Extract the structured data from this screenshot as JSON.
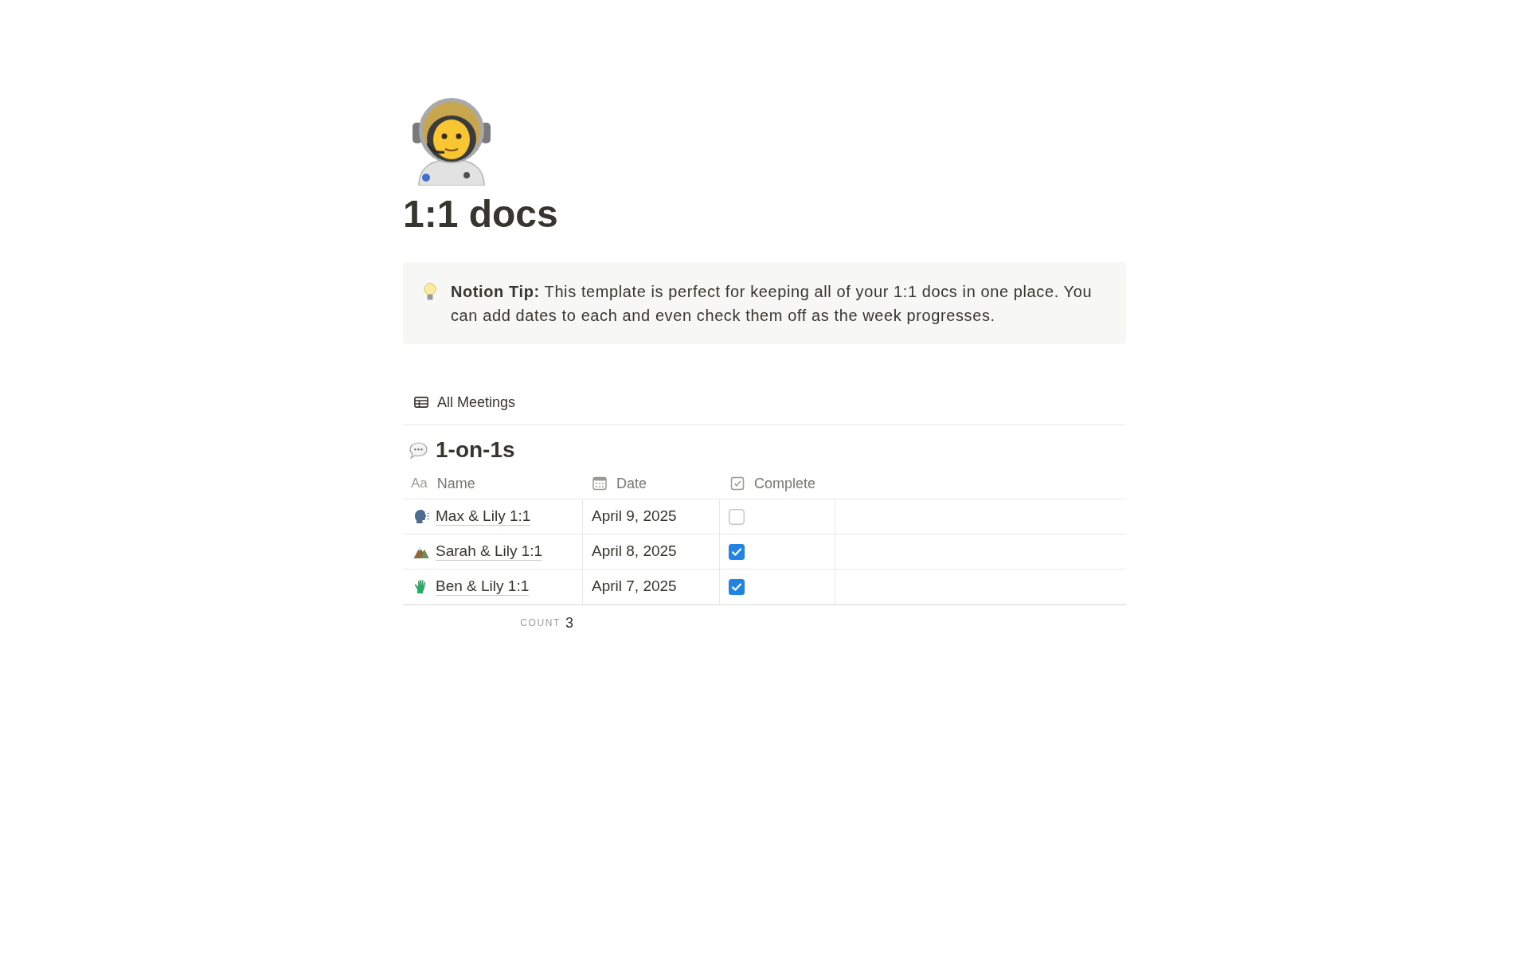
{
  "page": {
    "title": "1:1 docs"
  },
  "callout": {
    "text": "**Notion Tip:** This template is perfect for keeping all of your 1:1 docs in one place. You can add dates to each and even check them off as the week progresses."
  },
  "views": [
    {
      "label": "All Meetings"
    }
  ],
  "database": {
    "title": "1-on-1s",
    "columns": [
      {
        "kind": "title",
        "glyph": "Aa",
        "label": "Name"
      },
      {
        "kind": "date",
        "label": "Date"
      },
      {
        "kind": "checkbox",
        "label": "Complete"
      }
    ],
    "rows": [
      {
        "name": "Max & Lily 1:1",
        "date": "April 9, 2025",
        "complete": false
      },
      {
        "name": "Sarah & Lily 1:1",
        "date": "April 8, 2025",
        "complete": true
      },
      {
        "name": "Ben & Lily 1:1",
        "date": "April 7, 2025",
        "complete": true
      }
    ],
    "footer": {
      "label": "COUNT",
      "value": "3"
    }
  }
}
